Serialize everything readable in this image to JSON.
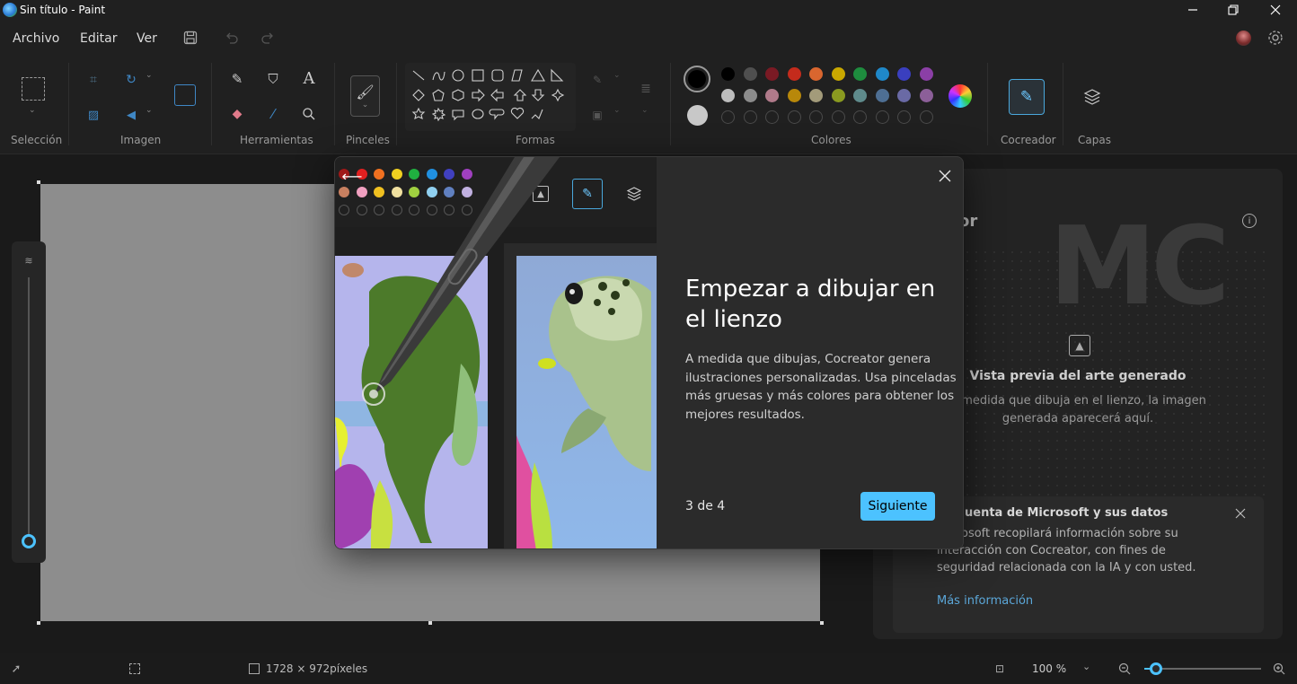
{
  "window": {
    "title": "Sin título - Paint"
  },
  "menu": {
    "archivo": "Archivo",
    "editar": "Editar",
    "ver": "Ver"
  },
  "ribbon": {
    "groups": {
      "seleccion": "Selección",
      "imagen": "Imagen",
      "herramientas": "Herramientas",
      "pinceles": "Pinceles",
      "formas": "Formas",
      "colores": "Colores",
      "cocreador": "Cocreador",
      "capas": "Capas"
    },
    "palette_row1": [
      "#000000",
      "#4f4f4f",
      "#7a1a24",
      "#c42b1c",
      "#d9662f",
      "#c9a800",
      "#1e8c3e",
      "#1f88c9",
      "#3a3fbf",
      "#8b3fa6"
    ],
    "palette_row2": [
      "#bdbdbd",
      "#8c8c8c",
      "#b07a8a",
      "#b8880a",
      "#a39b7a",
      "#8a9a20",
      "#5f8b8c",
      "#4e6f94",
      "#6a6aa5",
      "#8c5f99"
    ],
    "primary_color": "#000000",
    "secondary_color": "#c8c8c8"
  },
  "cocreator_panel": {
    "title_fragment": "or",
    "preview_title": "Vista previa del arte generado",
    "preview_text_1": "A medida que dibuja en el lienzo, la imagen",
    "preview_text_2": "generada aparecerá aquí.",
    "notice_title": "uenta de Microsoft y sus datos",
    "notice_line1": "osoft recopilará información sobre su",
    "notice_line2": "interacción con Cocreator, con fines de",
    "notice_line3": "seguridad relacionada con la IA y con usted.",
    "more_link": "Más información",
    "watermark": "MC"
  },
  "dialog": {
    "heading_line1": "Empezar a dibujar en",
    "heading_line2": "el lienzo",
    "body_line1": "A medida que dibujas, Cocreator genera",
    "body_line2": "ilustraciones personalizadas. Usa pinceladas",
    "body_line3": "más gruesas y más colores para obtener los",
    "body_line4": "mejores resultados.",
    "step": "3 de 4",
    "next_button": "Siguiente",
    "mini_palette_row1": [
      "#a01818",
      "#e02020",
      "#f07020",
      "#f0d020",
      "#20b040",
      "#2090e0",
      "#4040c0",
      "#a040c0"
    ],
    "mini_palette_row2": [
      "#c88060",
      "#f0a0c0",
      "#f0c020",
      "#f0e0a0",
      "#a0d040",
      "#90d0f0",
      "#6080c0",
      "#c0b0e0"
    ]
  },
  "status": {
    "canvas_size": "1728 × 972píxeles",
    "zoom": "100 %",
    "zoom_level": 0.1
  }
}
